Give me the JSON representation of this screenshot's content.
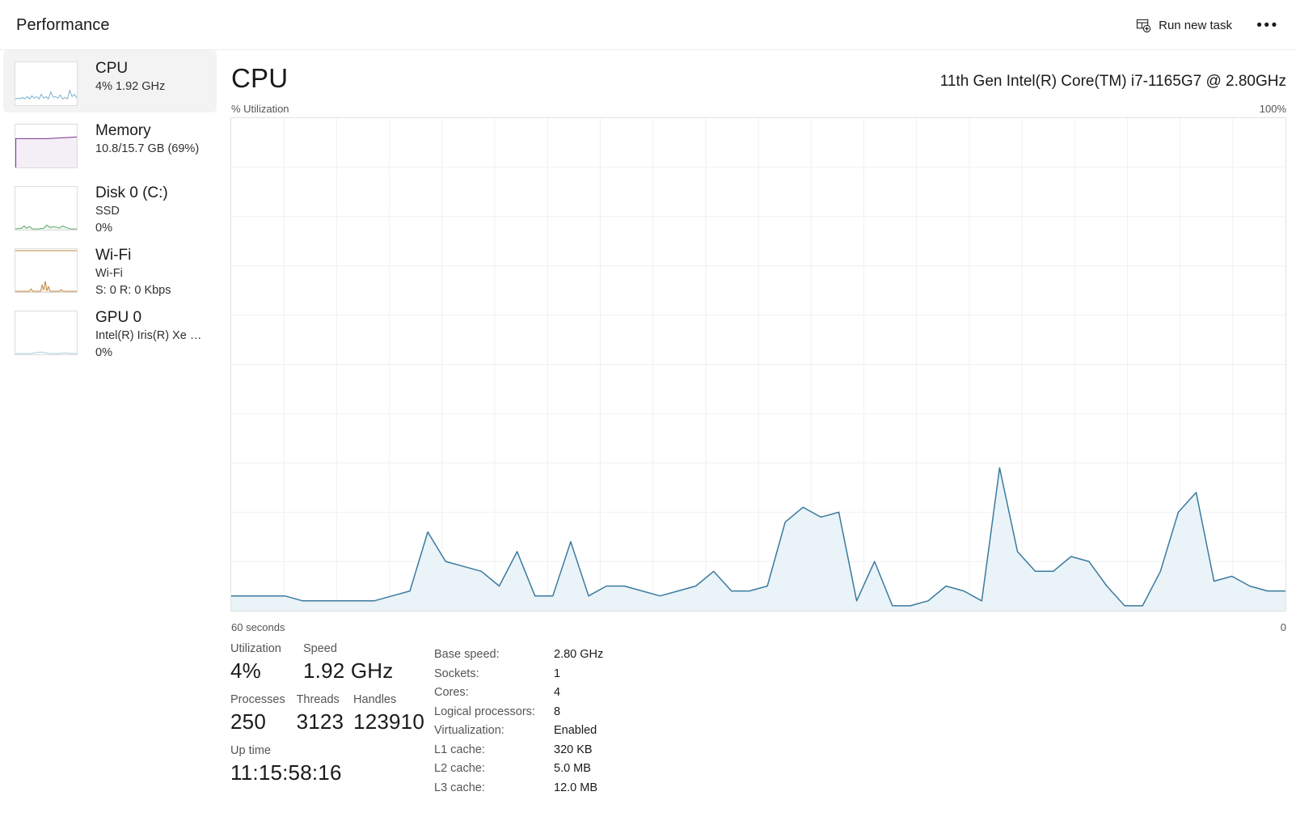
{
  "window": {
    "title": "Performance"
  },
  "toolbar": {
    "run_new_task_label": "Run new task",
    "run_new_task_icon": "new-task-window-plus-icon",
    "more_label": "•••",
    "more_icon": "ellipsis-icon"
  },
  "sidebar": {
    "items": [
      {
        "id": "cpu",
        "title": "CPU",
        "sub1": "4%  1.92 GHz",
        "sub2": "",
        "selected": true,
        "color": "#4a8cb5"
      },
      {
        "id": "memory",
        "title": "Memory",
        "sub1": "10.8/15.7 GB (69%)",
        "sub2": "",
        "selected": false,
        "color": "#77348f"
      },
      {
        "id": "disk0",
        "title": "Disk 0 (C:)",
        "sub1": "SSD",
        "sub2": "0%",
        "selected": false,
        "color": "#4a9c59"
      },
      {
        "id": "wifi",
        "title": "Wi-Fi",
        "sub1": "Wi-Fi",
        "sub2": "S: 0 R: 0 Kbps",
        "selected": false,
        "color": "#bb7a2e"
      },
      {
        "id": "gpu0",
        "title": "GPU 0",
        "sub1": "Intel(R) Iris(R) Xe Gra...",
        "sub2": "0%",
        "selected": false,
        "color": "#6aa6cc"
      }
    ]
  },
  "main": {
    "heading": "CPU",
    "model": "11th Gen Intel(R) Core(TM) i7-1165G7 @ 2.80GHz",
    "graph_label_left": "% Utilization",
    "graph_label_right": "100%",
    "axis_left": "60 seconds",
    "axis_right": "0"
  },
  "stats": {
    "utilization_label": "Utilization",
    "utilization_value": "4%",
    "speed_label": "Speed",
    "speed_value": "1.92 GHz",
    "processes_label": "Processes",
    "processes_value": "250",
    "threads_label": "Threads",
    "threads_value": "3123",
    "handles_label": "Handles",
    "handles_value": "123910",
    "uptime_label": "Up time",
    "uptime_value": "11:15:58:16"
  },
  "specs": [
    {
      "key": "Base speed:",
      "value": "2.80 GHz"
    },
    {
      "key": "Sockets:",
      "value": "1"
    },
    {
      "key": "Cores:",
      "value": "4"
    },
    {
      "key": "Logical processors:",
      "value": "8"
    },
    {
      "key": "Virtualization:",
      "value": "Enabled"
    },
    {
      "key": "L1 cache:",
      "value": "320 KB"
    },
    {
      "key": "L2 cache:",
      "value": "5.0 MB"
    },
    {
      "key": "L3 cache:",
      "value": "12.0 MB"
    }
  ],
  "colors": {
    "cpu_line": "#3a7a9e",
    "cpu_fill": "#eaf3f8",
    "grid": "#f0f0f0",
    "border": "#e2e2e2",
    "selected_row": "#f3f3f3"
  },
  "chart_data": {
    "type": "area",
    "title": "CPU % Utilization",
    "xlabel": "60 seconds",
    "ylabel": "% Utilization",
    "ylim": [
      0,
      100
    ],
    "xlim": [
      0,
      60
    ],
    "grid": true,
    "legend": "none",
    "y_axis_top_label": "100%",
    "y_axis_bottom_label": "0",
    "series": [
      {
        "name": "CPU Utilization",
        "color": "#3a7a9e",
        "fill": "#eaf3f8",
        "values": [
          3,
          3,
          3,
          3,
          2,
          2,
          2,
          2,
          2,
          3,
          4,
          16,
          10,
          9,
          8,
          5,
          12,
          3,
          3,
          14,
          3,
          5,
          5,
          4,
          3,
          4,
          5,
          8,
          4,
          4,
          5,
          18,
          21,
          19,
          20,
          2,
          10,
          1,
          1,
          2,
          5,
          4,
          2,
          29,
          12,
          8,
          8,
          11,
          10,
          5,
          1,
          1,
          8,
          20,
          24,
          6,
          7,
          5,
          4,
          4
        ]
      }
    ]
  }
}
